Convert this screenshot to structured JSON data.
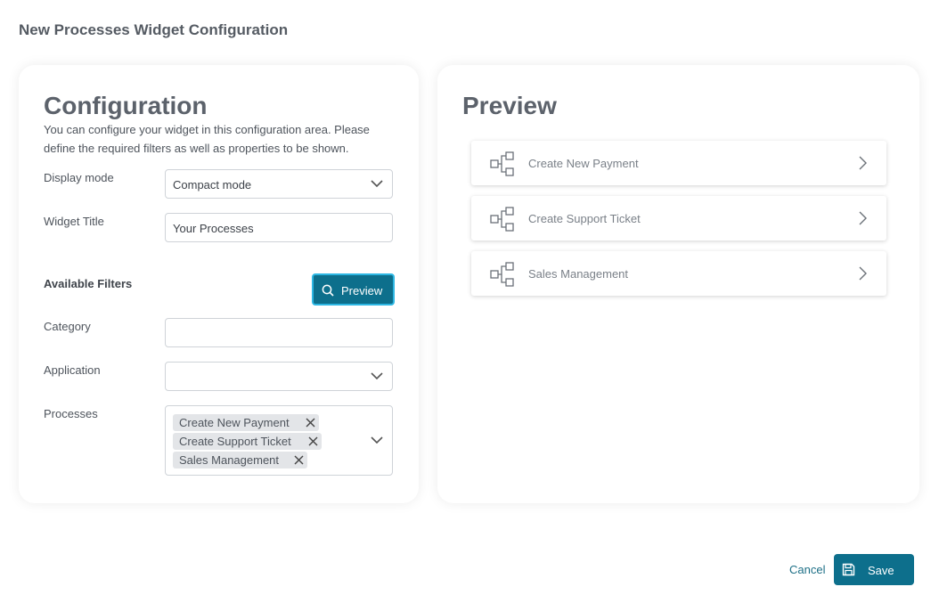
{
  "dialog": {
    "title": "New Processes Widget Configuration"
  },
  "config": {
    "title": "Configuration",
    "description": "You can configure your widget in this configuration area. Please define the required filters as well as properties to be shown.",
    "display_mode": {
      "label": "Display mode",
      "value": "Compact mode"
    },
    "widget_title": {
      "label": "Widget Title",
      "value": "Your Processes"
    },
    "available_filters_label": "Available Filters",
    "preview_button": "Preview",
    "category": {
      "label": "Category",
      "value": ""
    },
    "application": {
      "label": "Application",
      "value": ""
    },
    "processes": {
      "label": "Processes",
      "tags": [
        "Create New Payment",
        "Create Support Ticket",
        "Sales Management"
      ]
    }
  },
  "preview": {
    "title": "Preview",
    "items": [
      "Create New Payment",
      "Create Support Ticket",
      "Sales Management"
    ]
  },
  "footer": {
    "cancel": "Cancel",
    "save": "Save"
  },
  "colors": {
    "accent": "#0d6f8c",
    "focus_ring": "#2db7e3",
    "tag_bg": "#e3e5e8"
  }
}
